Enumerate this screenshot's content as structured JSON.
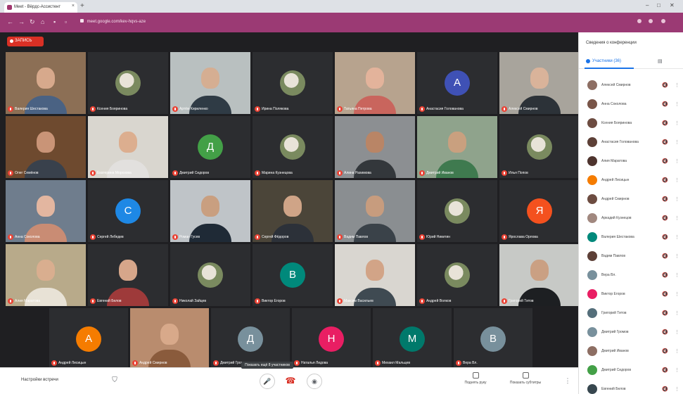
{
  "browser": {
    "tab_title": "Meet - Вёрдс-Ассистент",
    "address": "meet.google.com/kev-hqvs-aze",
    "new_tab": "+",
    "min": "–",
    "max": "□",
    "close": "✕"
  },
  "meet": {
    "recording_label": "ЗАПИСЬ",
    "tooltip": "Показать ещё 8 участников",
    "tiles": [
      {
        "name": "Валерия Шестакова",
        "kind": "video",
        "bg": "#8c6f55",
        "skin": "#d7a98c",
        "cloth": "#4a6283"
      },
      {
        "name": "Ксения Бояринова",
        "kind": "avatar-img"
      },
      {
        "name": "Артём Кириленко",
        "kind": "video",
        "bg": "#b9c0c0",
        "skin": "#d5ae92",
        "cloth": "#2f3b45"
      },
      {
        "name": "Ирина Полякова",
        "kind": "avatar-img"
      },
      {
        "name": "Татьяна Петрова",
        "kind": "video",
        "bg": "#b7a38e",
        "skin": "#e3b39b",
        "cloth": "#c9655d"
      },
      {
        "name": "Анастасия Голованова",
        "kind": "letter",
        "letter": "А",
        "color": "#3f51b5"
      },
      {
        "name": "Алексей Смирнов",
        "kind": "video",
        "bg": "#a8a49c",
        "skin": "#d9b39a",
        "cloth": "#2c3238"
      },
      {
        "name": "Олег Семёнов",
        "kind": "video",
        "bg": "#6e4a2f",
        "skin": "#c99477",
        "cloth": "#39414c"
      },
      {
        "name": "Екатерина Морозова",
        "kind": "video",
        "bg": "#d9d6cf",
        "skin": "#dcae8f",
        "cloth": "#e2e0de"
      },
      {
        "name": "Дмитрий Сидоров",
        "kind": "letter",
        "letter": "Д",
        "color": "#43a047"
      },
      {
        "name": "Марина Кузнецова",
        "kind": "avatar-img"
      },
      {
        "name": "Алина Рахимова",
        "kind": "video",
        "bg": "#8c8f92",
        "skin": "#b98566",
        "cloth": "#33373b"
      },
      {
        "name": "Дмитрий Иванов",
        "kind": "video",
        "bg": "#8fa38c",
        "skin": "#c9a07f",
        "cloth": "#3f7a4f"
      },
      {
        "name": "Илья Попов",
        "kind": "avatar-img"
      },
      {
        "name": "Анна Соколова",
        "kind": "video",
        "bg": "#6f7d8d",
        "skin": "#e3b6a0",
        "cloth": "#c98c74"
      },
      {
        "name": "Сергей Лебедев",
        "kind": "letter",
        "letter": "С",
        "color": "#1e88e5"
      },
      {
        "name": "Роман Гусев",
        "kind": "video",
        "bg": "#bfc4c8",
        "skin": "#c99f80",
        "cloth": "#1f2a36"
      },
      {
        "name": "Сергей Фёдоров",
        "kind": "video",
        "bg": "#4b4539",
        "skin": "#cfa487",
        "cloth": "#2c3139"
      },
      {
        "name": "Вадим Павлов",
        "kind": "video",
        "bg": "#8a8e91",
        "skin": "#c79c7e",
        "cloth": "#3a4249"
      },
      {
        "name": "Юрий Никитин",
        "kind": "avatar-img"
      },
      {
        "name": "Ярослава Орлова",
        "kind": "letter",
        "letter": "Я",
        "color": "#f4511e"
      },
      {
        "name": "Алия Маратова",
        "kind": "video",
        "bg": "#b8aa8a",
        "skin": "#d9ae8f",
        "cloth": "#e8e2d6"
      },
      {
        "name": "Евгений Белов",
        "kind": "video",
        "bg": "#2c2d30",
        "skin": "#d6a68a",
        "cloth": "#9e3a3a"
      },
      {
        "name": "Николай Зайцев",
        "kind": "avatar-img"
      },
      {
        "name": "Виктор Егоров",
        "kind": "letter",
        "letter": "В",
        "color": "#00897b"
      },
      {
        "name": "Максим Васильев",
        "kind": "video",
        "bg": "#d9d6d0",
        "skin": "#d2a487",
        "cloth": "#3f4a52"
      },
      {
        "name": "Андрей Волков",
        "kind": "avatar-img"
      },
      {
        "name": "Григорий Титов",
        "kind": "video",
        "bg": "#c7c9c6",
        "skin": "#caa083",
        "cloth": "#1d1f22"
      }
    ],
    "bottom_row": [
      {
        "name": "Андрей Лисицын",
        "kind": "letter",
        "letter": "А",
        "color": "#f57c00"
      },
      {
        "name": "Андрей Смирнов",
        "kind": "video",
        "bg": "#b98c6e",
        "skin": "#d8a98a",
        "cloth": "#8a5b3c"
      },
      {
        "name": "Дмитрий Громов",
        "kind": "letter",
        "letter": "Д",
        "color": "#78909c"
      },
      {
        "name": "Наталья Лидова",
        "kind": "letter",
        "letter": "Н",
        "color": "#e91e63"
      },
      {
        "name": "Михаил Мальцев",
        "kind": "letter",
        "letter": "М",
        "color": "#00796b"
      },
      {
        "name": "Вера Вл.",
        "kind": "letter",
        "letter": "В",
        "color": "#78909c"
      }
    ]
  },
  "bottom_bar": {
    "meeting_details": "Настройки встречи",
    "mic": "🎤",
    "end": "☎",
    "cam": "◉",
    "present": "Поднять руку",
    "captions": "Показать субтитры"
  },
  "sidebar": {
    "title": "Сведения о конференции",
    "tab_people": "Участники (36)",
    "tab_chat": "▤",
    "people": [
      {
        "name": "Алексей Смирнов",
        "color": "#8d6e63"
      },
      {
        "name": "Анна Соколова",
        "color": "#795548"
      },
      {
        "name": "Ксения Бояринова",
        "color": "#6d4c41"
      },
      {
        "name": "Анастасия Голованова",
        "color": "#5d4037"
      },
      {
        "name": "Алия Маратова",
        "color": "#4e342e"
      },
      {
        "name": "Андрей Лисицын",
        "color": "#f57c00"
      },
      {
        "name": "Андрей Смирнов",
        "color": "#6d4c41"
      },
      {
        "name": "Аркадий Кузнецов",
        "color": "#a1887f"
      },
      {
        "name": "Валерия Шестакова",
        "color": "#00897b"
      },
      {
        "name": "Вадим Павлов",
        "color": "#5d4037"
      },
      {
        "name": "Вера Вл.",
        "color": "#78909c"
      },
      {
        "name": "Виктор Егоров",
        "color": "#e91e63"
      },
      {
        "name": "Григорий Титов",
        "color": "#546e7a"
      },
      {
        "name": "Дмитрий Громов",
        "color": "#78909c"
      },
      {
        "name": "Дмитрий Иванов",
        "color": "#8d6e63"
      },
      {
        "name": "Дмитрий Сидоров",
        "color": "#43a047"
      },
      {
        "name": "Евгений Белов",
        "color": "#37474f"
      }
    ]
  }
}
